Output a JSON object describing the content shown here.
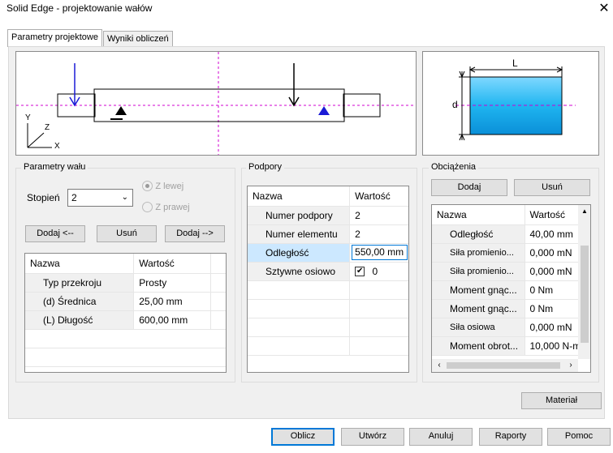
{
  "window": {
    "title": "Solid Edge - projektowanie wałów",
    "close_glyph": "✕"
  },
  "tabs": [
    {
      "label": "Parametry projektowe"
    },
    {
      "label": "Wyniki obliczeń"
    }
  ],
  "preview": {
    "axis_y": "Y",
    "axis_z": "Z",
    "axis_x": "X"
  },
  "dim_preview": {
    "label_L": "L",
    "label_d": "d"
  },
  "shaft_params": {
    "group_label": "Parametry wału",
    "step_label": "Stopień",
    "step_value": "2",
    "radio_left": "Z lewej",
    "radio_right": "Z prawej",
    "btn_add_left": "Dodaj <--",
    "btn_remove": "Usuń",
    "btn_add_right": "Dodaj -->",
    "col_name": "Nazwa",
    "col_value": "Wartość",
    "rows": [
      {
        "name": "Typ przekroju",
        "value": "Prosty"
      },
      {
        "name": "(d) Średnica",
        "value": "25,00 mm"
      },
      {
        "name": "(L) Długość",
        "value": "600,00 mm"
      }
    ]
  },
  "supports": {
    "group_label": "Podpory",
    "col_name": "Nazwa",
    "col_value": "Wartość",
    "rows": [
      {
        "name": "Numer podpory",
        "value": "2"
      },
      {
        "name": "Numer elementu",
        "value": "2"
      },
      {
        "name": "Odległość",
        "value": "550,00 mm"
      },
      {
        "name": "Sztywne osiowo",
        "value": "0"
      }
    ]
  },
  "loads": {
    "group_label": "Obciążenia",
    "btn_add": "Dodaj",
    "btn_remove": "Usuń",
    "col_name": "Nazwa",
    "col_value": "Wartość",
    "rows": [
      {
        "name": "Odległość",
        "value": "40,00 mm"
      },
      {
        "name": "Siła promienio...",
        "value": "0,000 mN"
      },
      {
        "name": "Siła promienio...",
        "value": "0,000 mN"
      },
      {
        "name": "Moment gnąc...",
        "value": "0 Nm"
      },
      {
        "name": "Moment gnąc...",
        "value": "0 Nm"
      },
      {
        "name": "Siła osiowa",
        "value": "0,000 mN"
      },
      {
        "name": "Moment obrot...",
        "value": "10,000 N-m"
      }
    ]
  },
  "material_button": "Materiał",
  "footer": {
    "calc": "Oblicz",
    "create": "Utwórz",
    "cancel": "Anuluj",
    "reports": "Raporty",
    "help": "Pomoc"
  },
  "colors": {
    "shaft_fill": "#1fb5f0",
    "arrow_blue": "#1a1ad6",
    "dash_magenta": "#d000d0"
  }
}
